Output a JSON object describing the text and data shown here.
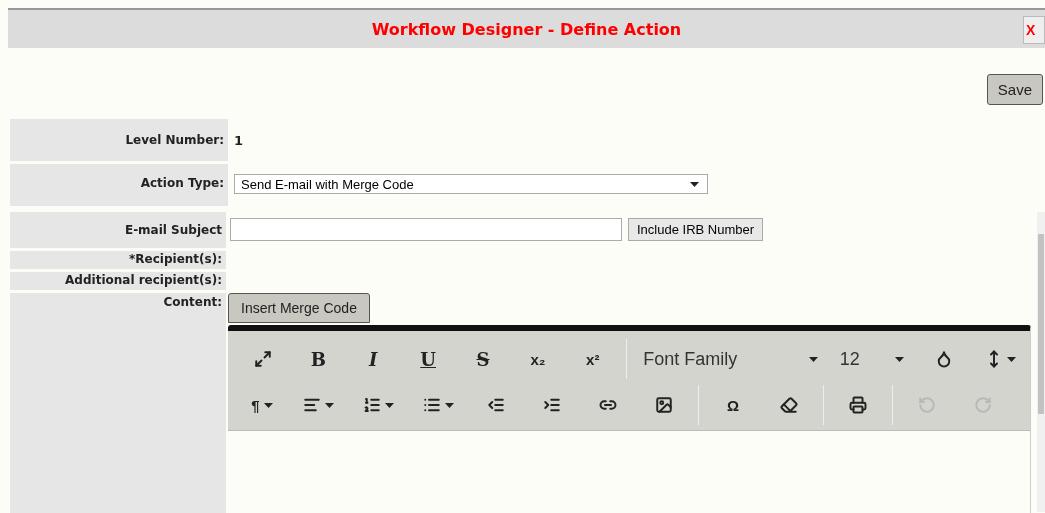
{
  "window": {
    "title": "Workflow Designer - Define Action",
    "close": "X"
  },
  "save_button": "Save",
  "fields": [
    {
      "kind": "text",
      "label": "Level Number:",
      "value": "1"
    },
    {
      "kind": "select",
      "label": "Action Type:",
      "value": "Send E-mail with Merge Code"
    }
  ],
  "email": [
    {
      "kind": "input",
      "label": "E-mail Subject",
      "button": "Include IRB Number"
    },
    {
      "kind": "empty",
      "label": "*Recipient(s):"
    },
    {
      "kind": "empty",
      "label": "Additional recipient(s):"
    },
    {
      "kind": "editor",
      "label": "Content:",
      "button": "Insert Merge Code"
    }
  ],
  "toolbar_rows": [
    [
      {
        "kind": "expand"
      },
      {
        "kind": "bold",
        "label": "B"
      },
      {
        "kind": "italic",
        "label": "I"
      },
      {
        "kind": "underline",
        "label": "U"
      },
      {
        "kind": "strike",
        "label": "S"
      },
      {
        "kind": "symbol",
        "label": "x₂"
      },
      {
        "kind": "symbol",
        "label": "x²"
      },
      {
        "kind": "separator"
      },
      {
        "kind": "dropdown",
        "label": "Font Family"
      },
      {
        "kind": "dropdown",
        "label": "12"
      },
      {
        "kind": "color"
      },
      {
        "kind": "lineheight"
      }
    ],
    [
      {
        "kind": "paragraph",
        "label": "¶"
      },
      {
        "kind": "align"
      },
      {
        "kind": "ordered"
      },
      {
        "kind": "bullets"
      },
      {
        "kind": "outdent"
      },
      {
        "kind": "indent"
      },
      {
        "kind": "link"
      },
      {
        "kind": "image"
      },
      {
        "kind": "separator"
      },
      {
        "kind": "symbol",
        "label": "Ω"
      },
      {
        "kind": "eraser"
      },
      {
        "kind": "separator"
      },
      {
        "kind": "print"
      },
      {
        "kind": "separator"
      },
      {
        "kind": "undo",
        "disabled": true
      },
      {
        "kind": "redo",
        "disabled": true
      }
    ]
  ]
}
